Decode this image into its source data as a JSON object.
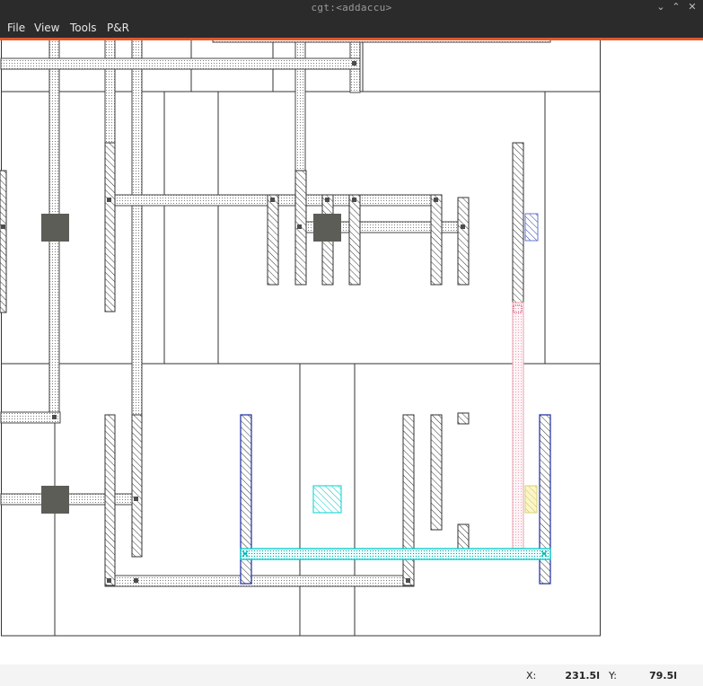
{
  "window": {
    "title": "cgt:<addaccu>",
    "controls": {
      "minimize": "⌄",
      "maximize": "⌃",
      "close": "✕"
    }
  },
  "menu": {
    "items": [
      {
        "id": "file",
        "label": "File"
      },
      {
        "id": "view",
        "label": "View"
      },
      {
        "id": "tools",
        "label": "Tools"
      },
      {
        "id": "pnr",
        "label": "P&R"
      }
    ]
  },
  "status": {
    "x_label": "X:",
    "x_value": "231.5l",
    "y_label": "Y:",
    "y_value": "79.5l"
  },
  "colors": {
    "menu_accent": "#e05a2b",
    "via_square": "#5d5d57",
    "metal_highlight": "#00c8c8",
    "pink_path": "#e8a0b0",
    "blue_outline": "#1a2aa0",
    "yellow_pad": "#d8d27a"
  }
}
